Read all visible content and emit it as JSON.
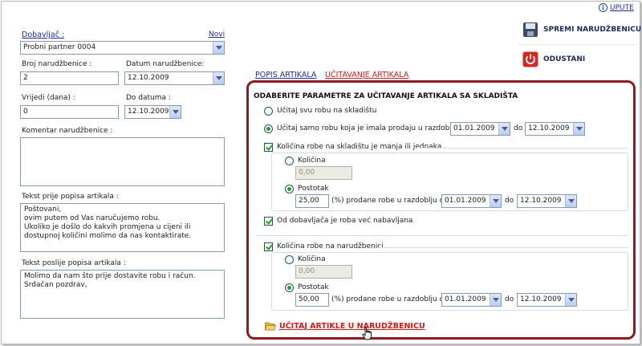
{
  "help": {
    "label": "UPUTE"
  },
  "actions": {
    "save_label": "SPREMI NARUDŽBENICU",
    "cancel_label": "ODUSTANI"
  },
  "supplier": {
    "label": "Dobavljač :",
    "new_link": "Novi",
    "value": "Probni partner 0004"
  },
  "order_number": {
    "label": "Broj narudžbenice :",
    "value": "2"
  },
  "order_date": {
    "label": "Datum narudžbenice:",
    "value": "12.10.2009"
  },
  "validity": {
    "label": "Vrijedi (dana) :",
    "value": "0"
  },
  "valid_until": {
    "label": "Do datuma :",
    "value": "12.10.2009"
  },
  "comment": {
    "label": "Komentar narudžbenice :",
    "value": ""
  },
  "text_before": {
    "label": "Tekst prije popisa artikala :",
    "value": "Poštovani,\novim putem od Vas naručujemo robu.\nUkoliko je došlo do kakvih promjena u cijeni ili\ndostupnoj količini molimo da nas kontaktirate."
  },
  "text_after": {
    "label": "Tekst poslije popisa artikala :",
    "value": "Molimo da nam što prije dostavite robu i račun.\nSrdačan pozdrav,"
  },
  "tabs": [
    {
      "label": "POPIS ARTIKALA",
      "active": false
    },
    {
      "label": "UČITAVANJE ARTIKALA",
      "active": true
    }
  ],
  "panel": {
    "title": "ODABERITE PARAMETRE ZA UČITAVANJE ARTIKALA SA SKLADIŠTA",
    "radio_all": {
      "label": "Učitaj svu robu na skladištu",
      "checked": false
    },
    "radio_sold": {
      "label": "Učitaj samo robu koja je imala prodaju u razdoblju od :",
      "checked": true,
      "from": "01.01.2009",
      "to_label": "do :",
      "to": "12.10.2009"
    },
    "stock_group": {
      "label": "Količina robe na skladištu je manja ili jednaka",
      "checked": true,
      "qty_label": "Količina",
      "qty_value": "0,00",
      "pct_label": "Postotak",
      "pct_value": "25,00",
      "pct_text": "(%) prodane robe u razdoblju od",
      "from": "01.01.2009",
      "to_label": "do :",
      "to": "12.10.2009"
    },
    "supplier_check": {
      "label": "Od dobavljača je roba već nabavljana",
      "checked": true
    },
    "ordered_group": {
      "label": "Količina robe na narudžbenici",
      "checked": true,
      "qty_label": "Količina",
      "qty_value": "0,00",
      "pct_label": "Postotak",
      "pct_value": "50,00",
      "pct_text": "(%) prodane robe u razdoblju od",
      "from": "01.01.2009",
      "to_label": "do :",
      "to": "12.10.2009"
    },
    "load_link": "UČITAJ ARTIKLE U NARUDŽBENICU"
  }
}
